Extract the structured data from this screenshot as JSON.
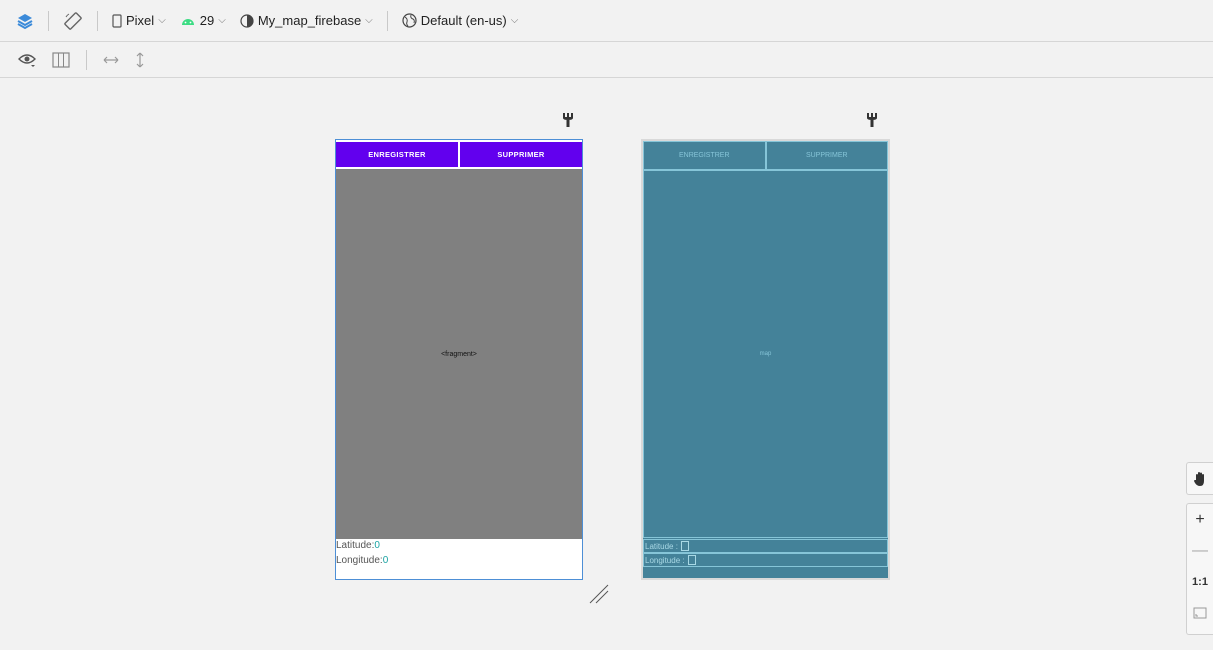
{
  "toolbar": {
    "layers_icon": "layers-icon",
    "orientation_icon": "orientation-icon",
    "device": "Pixel",
    "api": "29",
    "theme": "My_map_firebase",
    "locale": "Default (en-us)",
    "accent": "#6200ee",
    "android_green": "#3ddc84"
  },
  "toolbar2": {
    "eye_icon": "eye-icon",
    "layout_icon": "columns-icon",
    "horizontal_icon": "horizontal-arrows-icon",
    "vertical_icon": "vertical-arrows-icon"
  },
  "design": {
    "button1": "ENREGISTRER",
    "button2": "SUPPRIMER",
    "fragment": "<fragment>",
    "latitude_label": "Latitude:",
    "latitude_value": "0",
    "longitude_label": "Longitude:",
    "longitude_value": "0"
  },
  "blueprint": {
    "button1": "ENREGISTRER",
    "button2": "SUPPRIMER",
    "map": "map",
    "latitude_label": "Latitude :",
    "longitude_label": "Longitude :",
    "background": "#448299"
  },
  "zoom": {
    "zoom_in": "+",
    "zoom_out": "—",
    "one_to_one": "1:1"
  }
}
